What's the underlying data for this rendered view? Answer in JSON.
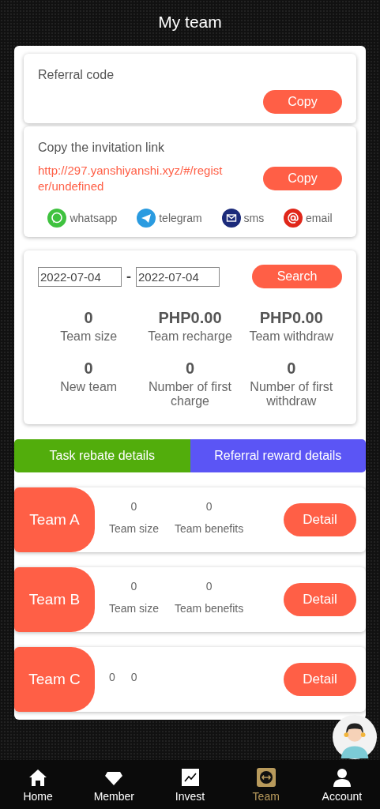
{
  "header": {
    "title": "My team"
  },
  "referral": {
    "label": "Referral code",
    "copy_button": "Copy"
  },
  "invitation": {
    "label": "Copy the invitation link",
    "link": "http://297.yanshiyanshi.xyz/#/register/undefined",
    "copy_button": "Copy",
    "share": [
      {
        "kind": "whatsapp",
        "label": "whatsapp"
      },
      {
        "kind": "telegram",
        "label": "telegram"
      },
      {
        "kind": "sms",
        "label": "sms"
      },
      {
        "kind": "email",
        "label": "email"
      }
    ]
  },
  "filter": {
    "start_date": "2022-07-04",
    "separator": "-",
    "end_date": "2022-07-04",
    "search_button": "Search"
  },
  "stats": [
    {
      "value": "0",
      "label": "Team size"
    },
    {
      "value": "PHP0.00",
      "label": "Team recharge"
    },
    {
      "value": "PHP0.00",
      "label": "Team withdraw"
    },
    {
      "value": "0",
      "label": "New team"
    },
    {
      "value": "0",
      "label": "Number of first charge"
    },
    {
      "value": "0",
      "label": "Number of first withdraw"
    }
  ],
  "detail_tabs": [
    {
      "label": "Task rebate details",
      "color": "#52ad0c"
    },
    {
      "label": "Referral reward details",
      "color": "#5b55f5"
    }
  ],
  "teams": [
    {
      "name": "Team A",
      "size": "0",
      "size_label": "Team size",
      "benefits": "0",
      "benefits_label": "Team benefits",
      "button": "Detail"
    },
    {
      "name": "Team B",
      "size": "0",
      "size_label": "Team size",
      "benefits": "0",
      "benefits_label": "Team benefits",
      "button": "Detail"
    },
    {
      "name": "Team C",
      "size": "0",
      "benefits": "0",
      "button": "Detail"
    }
  ],
  "nav": [
    {
      "kind": "home",
      "label": "Home",
      "selected": false
    },
    {
      "kind": "member",
      "label": "Member",
      "selected": false
    },
    {
      "kind": "invest",
      "label": "Invest",
      "selected": false
    },
    {
      "kind": "team",
      "label": "Team",
      "selected": true
    },
    {
      "kind": "account",
      "label": "Account",
      "selected": false
    }
  ]
}
